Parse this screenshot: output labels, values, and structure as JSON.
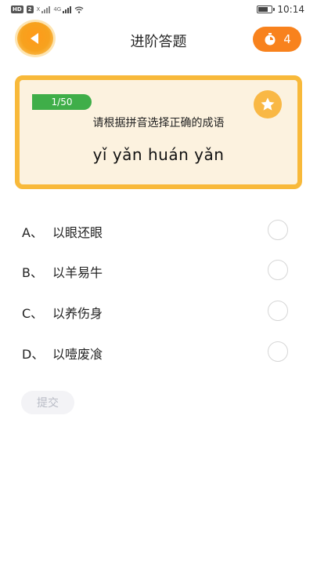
{
  "status_bar": {
    "badge": "HD",
    "sim_slot": "2",
    "network_1": "X",
    "network_2": "4G",
    "time": "10:14",
    "battery_level": 0.8
  },
  "header": {
    "title": "进阶答题",
    "timer_count": "4",
    "back_icon": "back-arrow-icon",
    "timer_icon": "stopwatch-icon"
  },
  "question": {
    "progress": "1/50",
    "prompt": "请根据拼音选择正确的成语",
    "pinyin": "yǐ yǎn huán yǎn",
    "favorite_icon": "star-icon"
  },
  "options": [
    {
      "letter": "A、",
      "text": "以眼还眼"
    },
    {
      "letter": "B、",
      "text": "以羊易牛"
    },
    {
      "letter": "C、",
      "text": "以养伤身"
    },
    {
      "letter": "D、",
      "text": "以噎废飡"
    }
  ],
  "submit_label": "提交",
  "colors": {
    "accent_orange": "#f8821d",
    "card_border": "#f8b93a",
    "card_bg": "#fcf2df",
    "progress_green": "#3fae49"
  }
}
